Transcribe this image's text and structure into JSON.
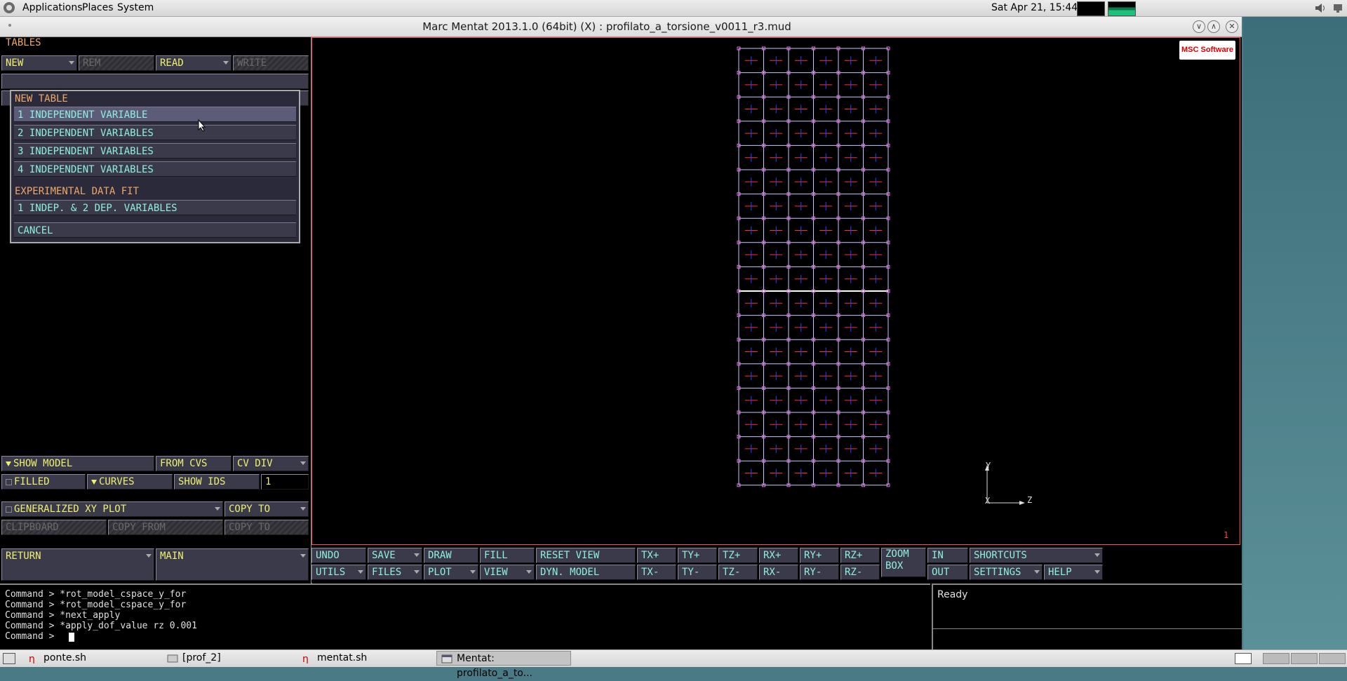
{
  "top_panel": {
    "menus": [
      "Applications",
      "Places",
      "System"
    ],
    "clock": "Sat Apr 21, 15:44"
  },
  "window": {
    "title": "Marc Mentat 2013.1.0 (64bit) (X) : profilato_a_torsione_v0011_r3.mud"
  },
  "left_panel": {
    "section_title": "TABLES",
    "top_buttons": {
      "new": "NEW",
      "rem": "REM",
      "read": "READ",
      "write": "WRITE"
    },
    "popup": {
      "header": "NEW TABLE",
      "items": [
        "1 INDEPENDENT VARIABLE",
        "2 INDEPENDENT VARIABLES",
        "3 INDEPENDENT VARIABLES",
        "4 INDEPENDENT VARIABLES"
      ],
      "section2_header": "EXPERIMENTAL DATA FIT",
      "section2_items": [
        "1 INDEP. & 2 DEP. VARIABLES"
      ],
      "cancel": "CANCEL"
    },
    "show_model": "SHOW MODEL",
    "from_cvs": "FROM CVS",
    "cv_div": "CV DIV",
    "filled": "FILLED",
    "curves": "CURVES",
    "show_ids": "SHOW IDS",
    "show_ids_value": "1",
    "generalized_xy_plot": "GENERALIZED XY PLOT",
    "copy_to": "COPY TO",
    "clipboard": "CLIPBOARD",
    "copy_from": "COPY FROM",
    "copy_to_disabled": "COPY TO",
    "return": "RETURN",
    "main": "MAIN"
  },
  "viewport": {
    "logo_text": "MSC Software",
    "axis": {
      "y": "Y",
      "x": "X",
      "z": "Z"
    },
    "viewport_number": "1"
  },
  "toolbar": {
    "row1": [
      "UNDO",
      "SAVE",
      "DRAW",
      "FILL",
      "RESET VIEW",
      "TX+",
      "TY+",
      "TZ+",
      "RX+",
      "RY+",
      "RZ+",
      "ZOOM BOX",
      "IN",
      "SHORTCUTS"
    ],
    "row2": [
      "UTILS",
      "FILES",
      "PLOT",
      "VIEW",
      "DYN. MODEL",
      "TX-",
      "TY-",
      "TZ-",
      "RX-",
      "RY-",
      "RZ-",
      "OUT",
      "SETTINGS",
      "HELP"
    ]
  },
  "command_history": [
    "Command > *rot_model_cspace_y_for",
    "Command > *rot_model_cspace_y_for",
    "Command > *next_apply",
    "Command > *apply_dof_value rz 0.001",
    "Command > "
  ],
  "status": "Ready",
  "taskbar": {
    "items": [
      "ponte.sh",
      "[prof_2]",
      "mentat.sh",
      "Mentat: profilato_a_to..."
    ]
  }
}
